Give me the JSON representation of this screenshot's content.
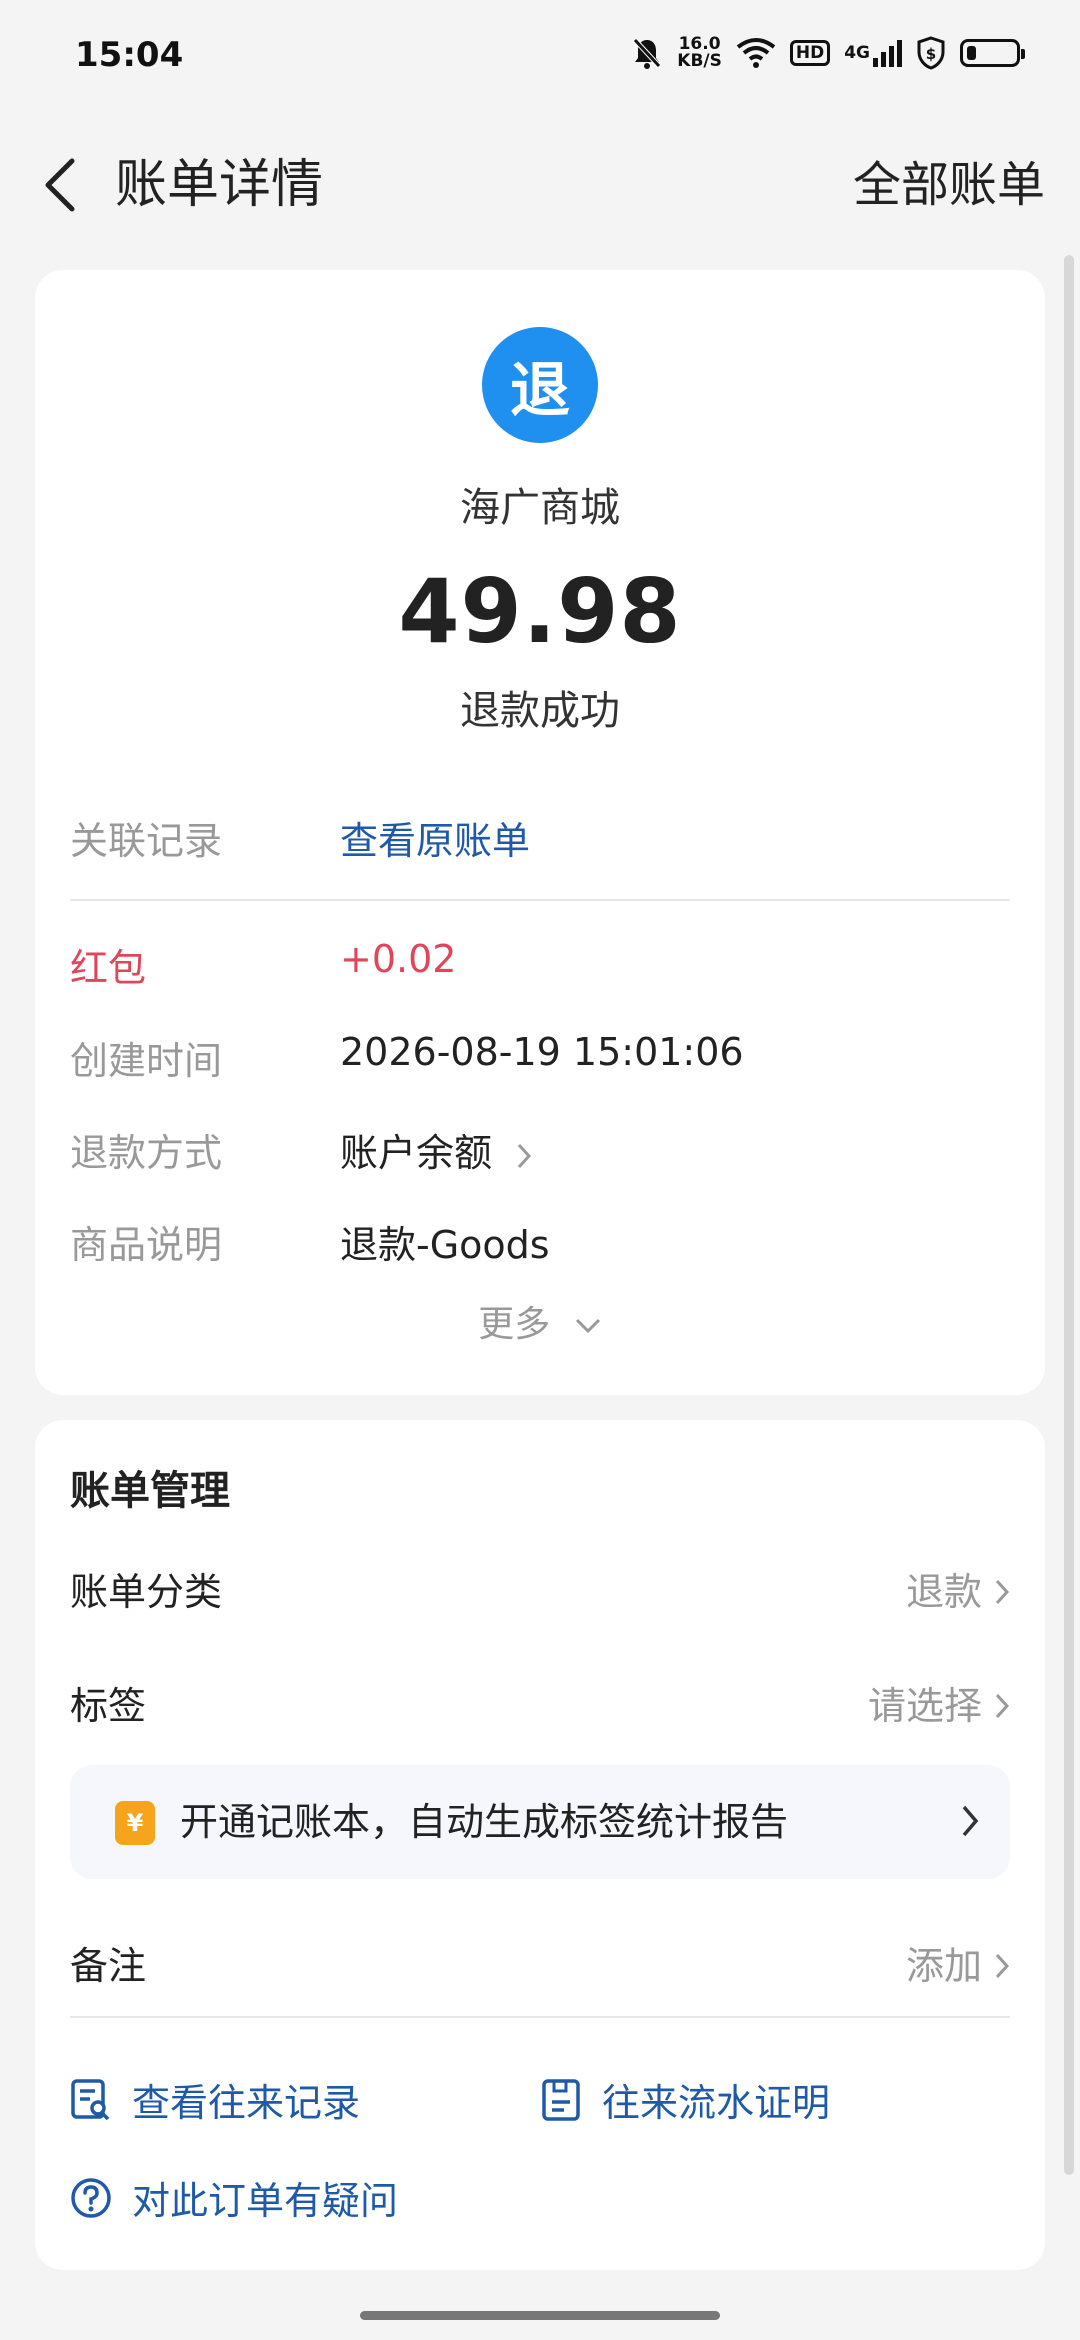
{
  "status_bar": {
    "time": "15:04",
    "net_speed_value": "16.0",
    "net_speed_unit": "KB/S",
    "hd": "HD",
    "network": "4G",
    "battery_level": 0.2,
    "icons": [
      "mute-bell-icon",
      "wifi-icon",
      "hd-icon",
      "signal-icon",
      "shield-icon",
      "battery-icon"
    ]
  },
  "header": {
    "back_icon": "chevron-left-icon",
    "title": "账单详情",
    "all_bills": "全部账单"
  },
  "detail": {
    "logo_char": "退",
    "merchant": "海广商城",
    "amount": "49.98",
    "status": "退款成功",
    "related_label": "关联记录",
    "related_value": "查看原账单",
    "rows": [
      {
        "label": "红包",
        "value": "+0.02"
      },
      {
        "label": "创建时间",
        "value": "2026-08-19 15:01:06"
      },
      {
        "label": "退款方式",
        "value": "账户余额"
      },
      {
        "label": "商品说明",
        "value": "退款-Goods"
      }
    ],
    "more": "更多"
  },
  "manage": {
    "title": "账单管理",
    "category_label": "账单分类",
    "category_value": "退款",
    "tag_label": "标签",
    "tag_value": "请选择",
    "promo_icon_char": "¥",
    "promo_text": "开通记账本，自动生成标签统计报告",
    "note_label": "备注",
    "note_value": "添加",
    "actions": {
      "history": "查看往来记录",
      "proof": "往来流水证明",
      "question": "对此订单有疑问"
    }
  },
  "colors": {
    "accent_blue": "#1e5aa8",
    "logo_blue": "#1f8ff0",
    "red": "#e0455a",
    "promo_orange": "#f6a41c"
  }
}
